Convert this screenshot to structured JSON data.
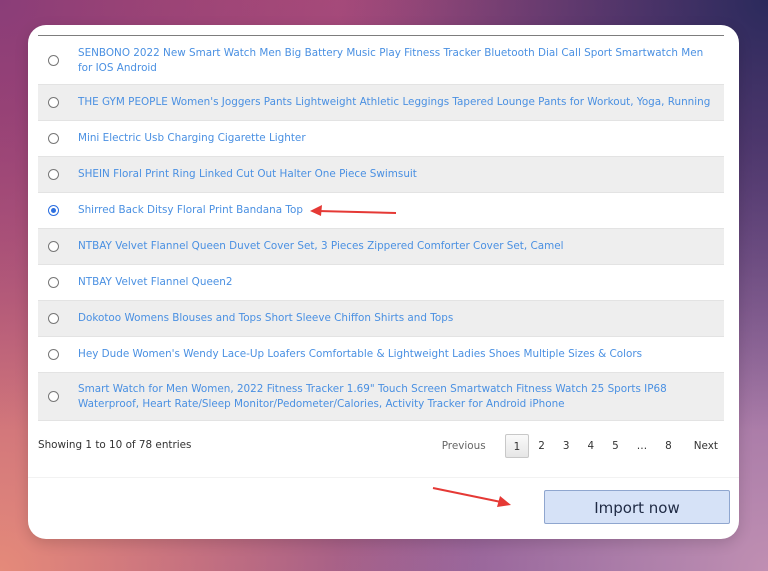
{
  "products": [
    {
      "title": "SENBONO 2022 New Smart Watch Men Big Battery Music Play Fitness Tracker Bluetooth Dial Call Sport Smartwatch Men for IOS Android",
      "selected": false
    },
    {
      "title": "THE GYM PEOPLE Women's Joggers Pants Lightweight Athletic Leggings Tapered Lounge Pants for Workout, Yoga, Running",
      "selected": false
    },
    {
      "title": "Mini Electric Usb Charging Cigarette Lighter",
      "selected": false
    },
    {
      "title": "SHEIN Floral Print Ring Linked Cut Out Halter One Piece Swimsuit",
      "selected": false
    },
    {
      "title": "Shirred Back Ditsy Floral Print Bandana Top",
      "selected": true
    },
    {
      "title": "NTBAY Velvet Flannel Queen Duvet Cover Set, 3 Pieces Zippered Comforter Cover Set, Camel",
      "selected": false
    },
    {
      "title": "NTBAY Velvet Flannel Queen2",
      "selected": false
    },
    {
      "title": "Dokotoo Womens Blouses and Tops Short Sleeve Chiffon Shirts and Tops",
      "selected": false
    },
    {
      "title": "Hey Dude Women's Wendy Lace-Up Loafers Comfortable & Lightweight Ladies Shoes Multiple Sizes & Colors",
      "selected": false
    },
    {
      "title": "Smart Watch for Men Women, 2022 Fitness Tracker 1.69\" Touch Screen Smartwatch Fitness Watch 25 Sports IP68 Waterproof, Heart Rate/Sleep Monitor/Pedometer/Calories, Activity Tracker for Android iPhone",
      "selected": false
    }
  ],
  "footer": {
    "info": "Showing 1 to 10 of 78 entries"
  },
  "pagination": {
    "previous": "Previous",
    "pages": [
      "1",
      "2",
      "3",
      "4",
      "5",
      "…",
      "8"
    ],
    "current": "1",
    "next": "Next"
  },
  "import_button": "Import now",
  "colors": {
    "link": "#4a90e2",
    "arrow": "#e53935",
    "button_bg": "#d6e2f7"
  }
}
